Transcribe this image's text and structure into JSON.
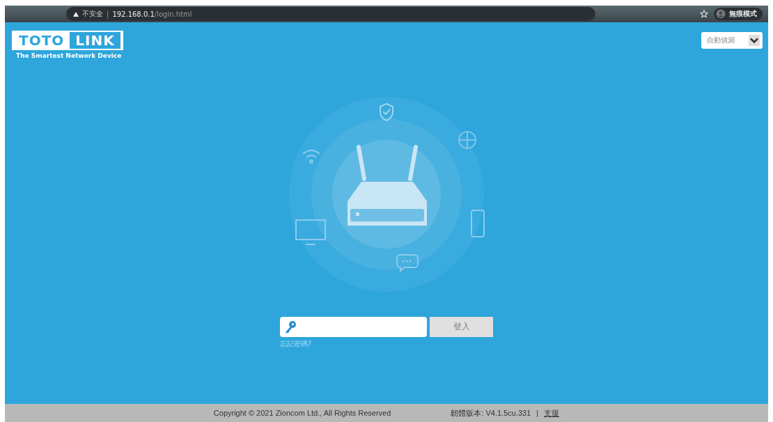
{
  "browser": {
    "security_label": "不安全",
    "url_separator": "|",
    "url_host": "192.168.0.1",
    "url_path": "/login.html",
    "profile_label": "無痕模式"
  },
  "logo": {
    "word_1": "TOTO",
    "word_2": "LINK",
    "tagline": "The Smartest Network Device"
  },
  "language_select": {
    "value": "自動偵測"
  },
  "login": {
    "button": "登入",
    "disabled": true,
    "forgot_link": "忘記密碼?"
  },
  "footer": {
    "copyright": "Copyright © 2021 Zioncom Ltd., All Rights Reserved",
    "firmware": "韌體版本: V4.1.5cu.331",
    "separator": "|",
    "support_link": "支援"
  }
}
